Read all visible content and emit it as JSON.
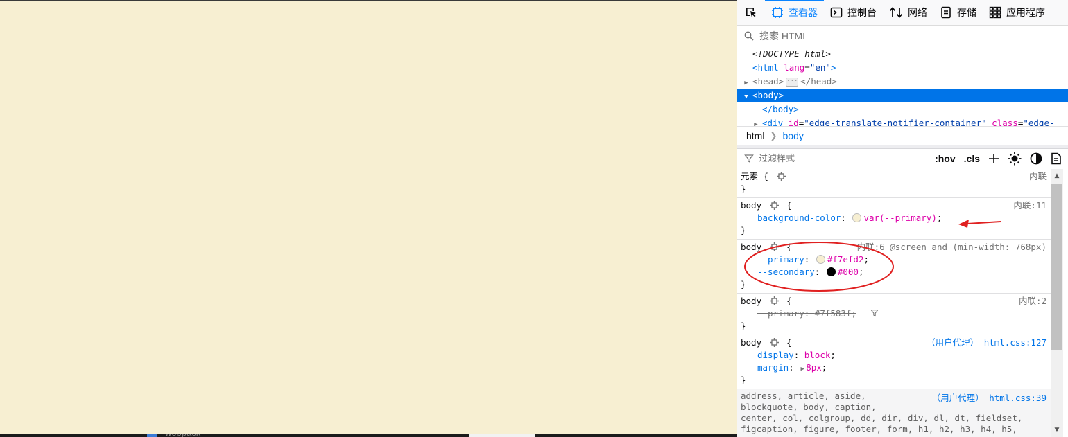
{
  "page": {
    "background": "#f7efd2",
    "taskbar_label": "webpack"
  },
  "devtools": {
    "tabs": [
      {
        "label": "查看器",
        "icon": "inspector-icon",
        "active": true
      },
      {
        "label": "控制台",
        "icon": "console-icon"
      },
      {
        "label": "网络",
        "icon": "network-icon"
      },
      {
        "label": "存储",
        "icon": "storage-icon"
      },
      {
        "label": "应用程序",
        "icon": "application-icon"
      }
    ],
    "search": {
      "placeholder": "搜索 HTML"
    },
    "markup": {
      "doctype": "<!DOCTYPE html>",
      "html_open": "html",
      "lang_attr": "lang",
      "lang_val": "\"en\"",
      "head_open": "<head>",
      "head_close": "</head>",
      "body_open": "<body>",
      "body_close": "</body>",
      "div_partial_tag": "div",
      "div_partial_id": "id",
      "div_partial_id_val": "\"edge-translate-notifier-container\"",
      "div_partial_class": "class",
      "div_partial_class_val": "\"edge-"
    },
    "breadcrumb": [
      "html",
      "body"
    ],
    "rules_toolbar": {
      "filter_placeholder": "过滤样式",
      "hov": ":hov",
      "cls": ".cls"
    },
    "rules": {
      "element": {
        "selector": "元素 {",
        "source": "内联",
        "close": "}"
      },
      "r1": {
        "selector": "body",
        "open": "{",
        "source": "内联:11",
        "prop": "background-color",
        "value": "var(--primary)",
        "swatch": "#f7efd2",
        "close": "}"
      },
      "r2": {
        "selector": "body",
        "open": "{",
        "source": "内联:6 @screen and (min-width: 768px)",
        "p1": "--primary",
        "v1": "#f7efd2",
        "sw1": "#f7efd2",
        "p2": "--secondary",
        "v2": "#000",
        "sw2": "#000000",
        "close": "}"
      },
      "r3": {
        "selector": "body",
        "open": "{",
        "source": "内联:2",
        "prop": "--primary",
        "value": "#7f583f",
        "close": "}"
      },
      "r4": {
        "selector": "body",
        "open": "{",
        "source_zh": "（用户代理）",
        "source_file": "html.css:127",
        "p1": "display",
        "v1": "block",
        "p2": "margin",
        "v2": "8px",
        "close": "}"
      },
      "r5": {
        "source_zh": "（用户代理）",
        "source_file": "html.css:39",
        "lines": [
          "address, article, aside,",
          "blockquote, body, caption,",
          "center, col, colgroup, dd, dir, div, dl, dt, fieldset,",
          "figcaption, figure, footer, form, h1, h2, h3, h4, h5,"
        ]
      }
    }
  },
  "annotation_color": "#e02020"
}
